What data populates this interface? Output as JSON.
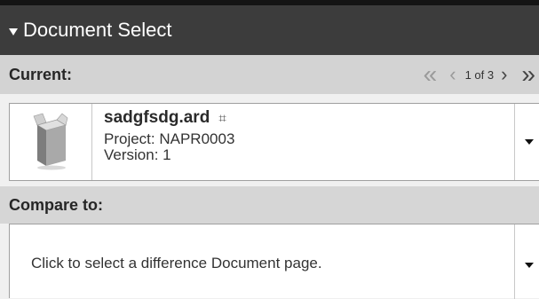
{
  "panel": {
    "title": "Document Select"
  },
  "current": {
    "label": "Current:",
    "pager": {
      "first_glyph": "«",
      "prev_glyph": "‹",
      "count": "1 of 3",
      "next_glyph": "›",
      "last_glyph": "»"
    },
    "document": {
      "name": "sadgfsdg.ard",
      "project": "Project: NAPR0003",
      "version": "Version: 1",
      "grid_glyph": "⌗"
    }
  },
  "compare": {
    "label": "Compare to:",
    "placeholder": "Click to select a difference Document page."
  },
  "icons": {
    "panel_toggle": "triangle-down-icon",
    "thumbnail": "box-thumbnail-icon",
    "dropdown": "caret-down-icon",
    "doc_type": "grid-icon"
  },
  "colors": {
    "header_bg": "#3c3c3c",
    "section_bg": "#d3d3d3",
    "nav_color": "#6a6a6a"
  }
}
